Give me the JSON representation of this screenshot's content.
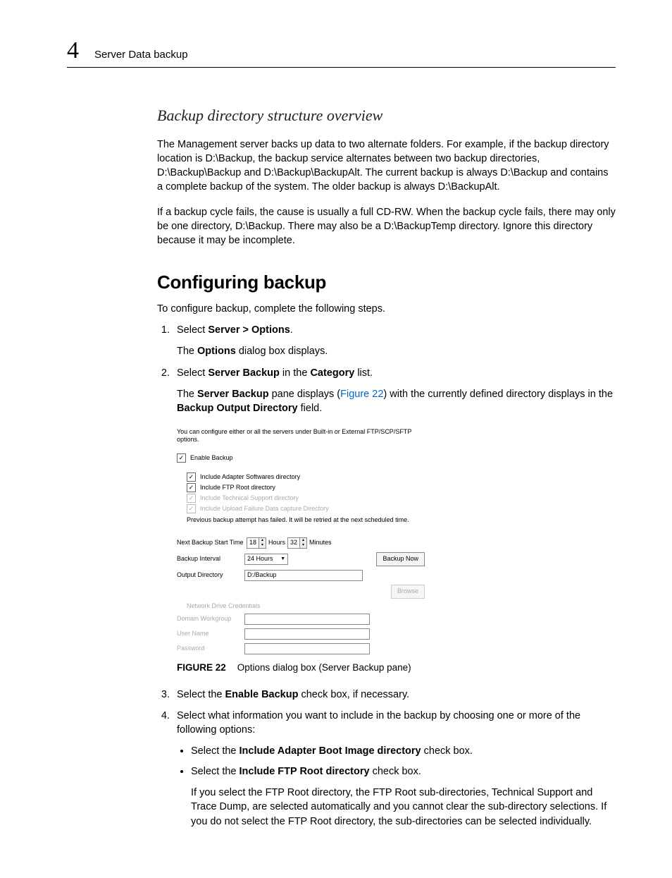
{
  "header": {
    "chapter": "4",
    "title": "Server Data backup"
  },
  "section1": {
    "heading": "Backup directory structure overview",
    "p1": "The Management server backs up data to two alternate folders. For example, if the backup directory location is D:\\Backup, the backup service alternates between two backup directories, D:\\Backup\\Backup and D:\\Backup\\BackupAlt. The current backup is always D:\\Backup and contains a complete backup of the system. The older backup is always D:\\BackupAlt.",
    "p2": "If a backup cycle fails, the cause is usually a full CD-RW. When the backup cycle fails, there may only be one directory, D:\\Backup. There may also be a D:\\BackupTemp directory. Ignore this directory because it may be incomplete."
  },
  "section2": {
    "heading": "Configuring backup",
    "intro": "To configure backup, complete the following steps.",
    "step1a": "Select ",
    "step1b": "Server > Options",
    "step1c": ".",
    "step1res_a": "The ",
    "step1res_b": "Options",
    "step1res_c": " dialog box displays.",
    "step2a": "Select ",
    "step2b": "Server Backup",
    "step2c": " in the ",
    "step2d": "Category",
    "step2e": " list.",
    "step2res_a": "The ",
    "step2res_b": "Server Backup",
    "step2res_c": " pane displays (",
    "step2res_link": "Figure 22",
    "step2res_d": ") with the currently defined directory displays in the ",
    "step2res_e": "Backup Output Directory",
    "step2res_f": " field.",
    "step3a": "Select the ",
    "step3b": "Enable Backup",
    "step3c": " check box, if necessary.",
    "step4": "Select what information you want to include in the backup by choosing one or more of the following options:",
    "step4_b1a": "Select the ",
    "step4_b1b": "Include Adapter Boot Image directory",
    "step4_b1c": " check box.",
    "step4_b2a": "Select the ",
    "step4_b2b": "Include FTP Root directory",
    "step4_b2c": " check box.",
    "step4_b2_extra": "If you select the FTP Root directory, the FTP Root sub-directories, Technical Support and Trace Dump, are selected automatically and you cannot clear the sub-directory selections. If you do not select the FTP Root directory, the sub-directories can be selected individually."
  },
  "figure": {
    "intro": "You can configure either or all the servers under Built-in or External FTP/SCP/SFTP options.",
    "enable": "Enable Backup",
    "inc1": "Include Adapter Softwares directory",
    "inc2": "Include FTP Root directory",
    "inc3": "Include Technical Support directory",
    "inc4": "Include Upload Failure Data capture Directory",
    "warn": "Previous backup attempt has failed. It will be retried at the next scheduled time.",
    "nbst": "Next Backup Start Time",
    "hours_val": "18",
    "hours_lbl": "Hours",
    "mins_val": "32",
    "mins_lbl": "Minutes",
    "interval_lbl": "Backup Interval",
    "interval_val": "24 Hours",
    "backup_now": "Backup Now",
    "outdir_lbl": "Output Directory",
    "outdir_val": "D:/Backup",
    "browse": "Browse",
    "ndc": "Network Drive Credentials",
    "domain": "Domain Workgroup",
    "user": "User Name",
    "pass": "Password",
    "caption_label": "FIGURE 22",
    "caption_text": "Options dialog box (Server Backup pane)"
  }
}
